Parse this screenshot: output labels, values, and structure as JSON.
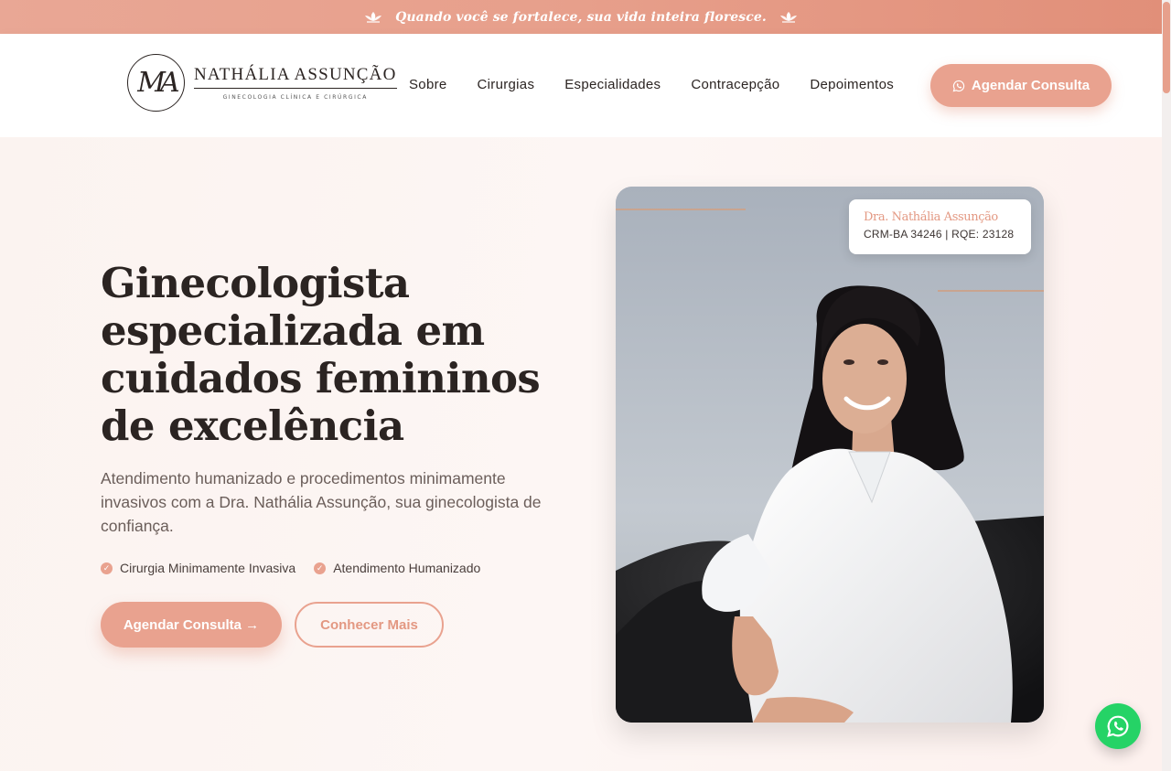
{
  "topbar": {
    "quote": "Quando você se fortalece, sua vida inteira floresce."
  },
  "logo": {
    "monogram": "MA",
    "name": "NATHÁLIA ASSUNÇÃO",
    "tagline": "GINECOLOGIA CLÍNICA E CIRÚRGICA"
  },
  "nav": {
    "items": [
      "Sobre",
      "Cirurgias",
      "Especialidades",
      "Contracepção",
      "Depoimentos"
    ]
  },
  "header": {
    "cta_label": "Agendar Consulta"
  },
  "hero": {
    "title": "Ginecologista especializada em cuidados femininos de excelência",
    "subtitle": "Atendimento humanizado e procedimentos minimamente invasivos com a Dra. Nathália Assunção, sua ginecologista de confiança.",
    "features": [
      "Cirurgia Minimamente Invasiva",
      "Atendimento Humanizado"
    ],
    "primary_cta": "Agendar Consulta →",
    "secondary_cta": "Conhecer Mais"
  },
  "doctor_card": {
    "name": "Dra. Nathália Assunção",
    "registration": "CRM-BA 34246 | RQE: 23128"
  },
  "colors": {
    "accent": "#e9a28f",
    "text": "#2b2422",
    "whatsapp": "#25d366"
  },
  "icons": {
    "topbar": "lotus-icon",
    "check": "check-circle-icon",
    "whatsapp": "whatsapp-icon"
  }
}
